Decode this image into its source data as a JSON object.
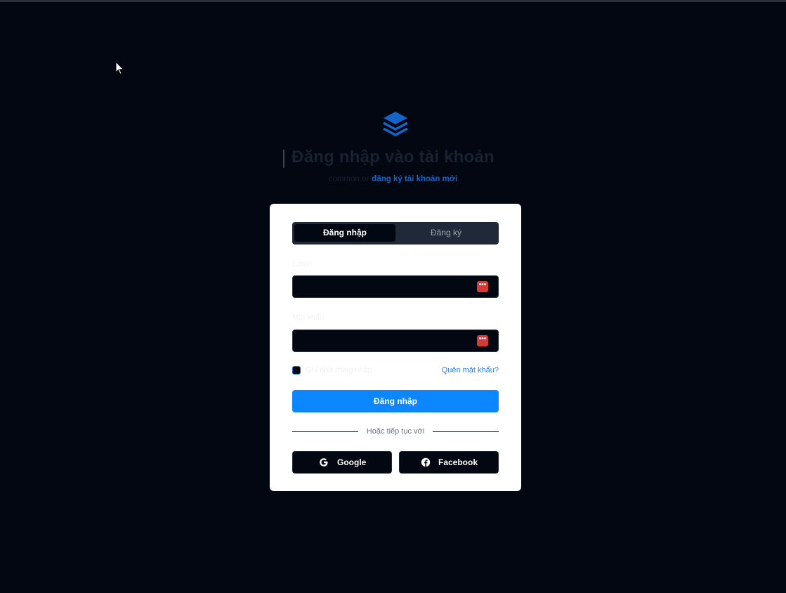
{
  "header": {
    "logo_icon": "layers-icon",
    "title": "Đăng nhập vào tài khoản",
    "subtitle_prefix": "common.or",
    "subtitle_link": "đăng ký tài khoản mới"
  },
  "tabs": [
    {
      "label": "Đăng nhập",
      "active": true
    },
    {
      "label": "Đăng ký",
      "active": false
    }
  ],
  "form": {
    "email_label": "Email",
    "email_value": "",
    "password_label": "Mật khẩu",
    "password_value": "",
    "password_manager_icon": "ellipsis-icon",
    "password_manager_glyph": "•••",
    "remember_label": "Ghi nhớ đăng nhập",
    "remember_checked": false,
    "forgot_link": "Quên mật khẩu?",
    "submit_label": "Đăng nhập"
  },
  "divider_text": "Hoặc tiếp tục với",
  "social": {
    "google_label": "Google",
    "facebook_label": "Facebook"
  },
  "colors": {
    "background": "#030712",
    "card": "#ffffff",
    "primary": "#0d87ff",
    "link": "#1565c8",
    "badge": "#d33a3a"
  }
}
